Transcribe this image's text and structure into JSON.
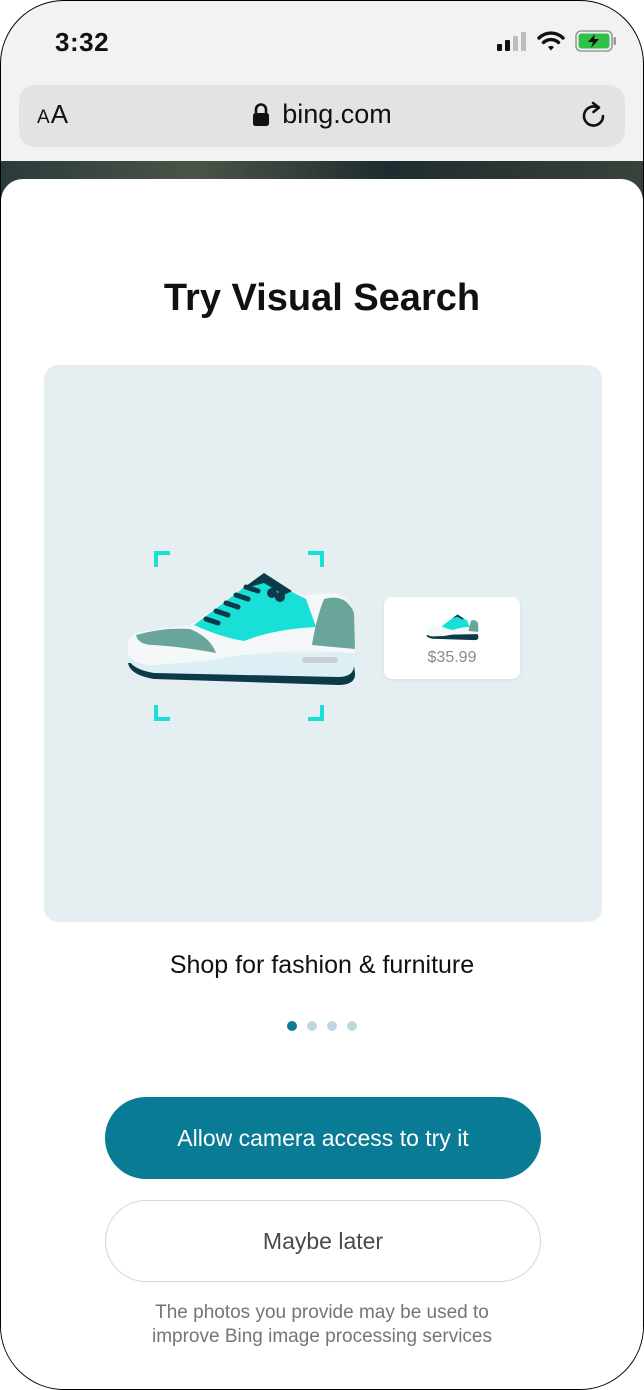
{
  "status_bar": {
    "time": "3:32"
  },
  "browser": {
    "text_size_label_small": "A",
    "text_size_label_large": "A",
    "url": "bing.com"
  },
  "sheet": {
    "title": "Try Visual Search",
    "result_price": "$35.99",
    "caption": "Shop for fashion & furniture",
    "carousel": {
      "total_pages": 4,
      "active_page": 1
    },
    "primary_button": "Allow camera access to try it",
    "secondary_button": "Maybe later",
    "disclaimer_line1": "The photos you provide may be used to",
    "disclaimer_line2": "improve Bing image processing services"
  },
  "colors": {
    "accent": "#0a7b94",
    "shoe_teal": "#19e0d6",
    "illustration_bg": "#e5eff2"
  },
  "icons": [
    "signal-icon",
    "wifi-icon",
    "battery-charging-icon",
    "lock-icon",
    "reload-icon",
    "scan-corner-icon",
    "sneaker-icon"
  ]
}
